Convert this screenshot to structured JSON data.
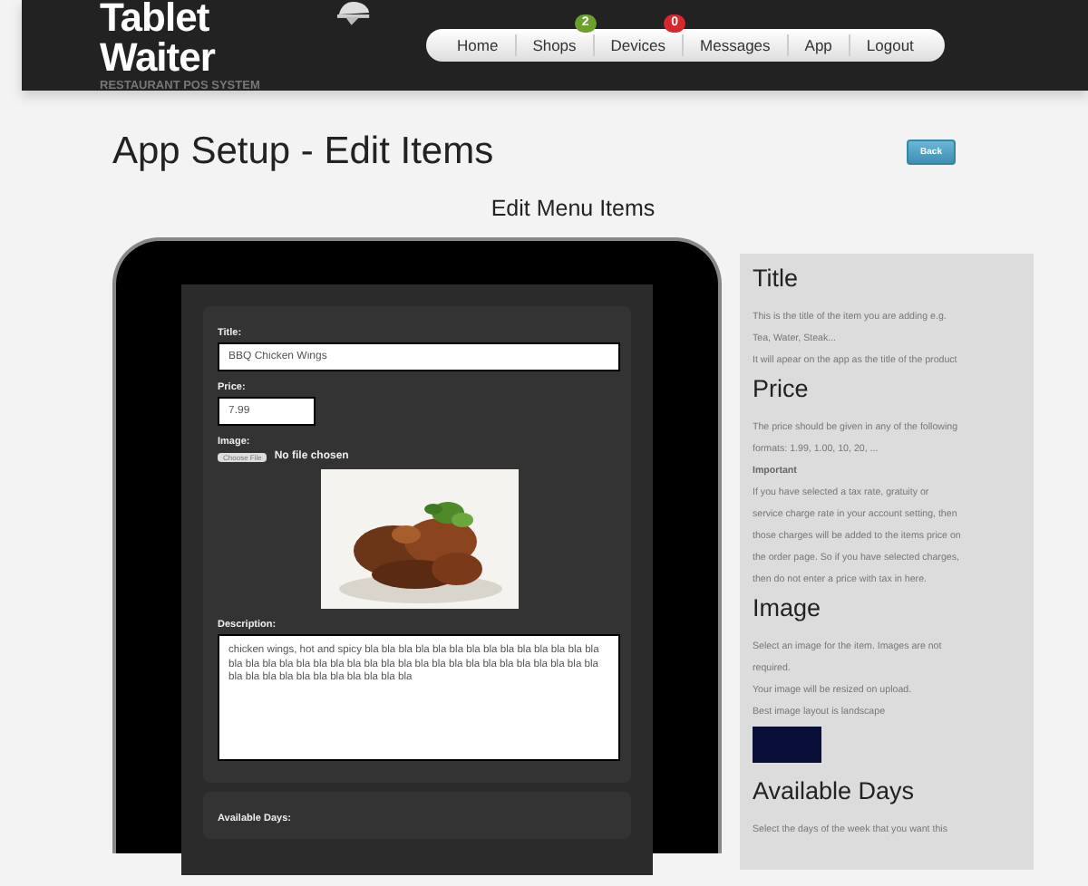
{
  "header": {
    "logo": "Tablet Waiter",
    "tagline": "RESTAURANT POS SYSTEM",
    "nav": [
      {
        "label": "Home"
      },
      {
        "label": "Shops",
        "badge": "2",
        "color": "#6aa12c"
      },
      {
        "label": "Devices",
        "badge": "0",
        "color": "#d8272d"
      },
      {
        "label": "Messages"
      },
      {
        "label": "App"
      },
      {
        "label": "Logout"
      }
    ]
  },
  "page": {
    "title": "App Setup - Edit Items",
    "back_button": "Back",
    "subtitle": "Edit Menu Items"
  },
  "form": {
    "title_label": "Title:",
    "title_value": "BBQ Chicken Wings",
    "price_label": "Price:",
    "price_value": "7.99",
    "image_label": "Image:",
    "file_button": "Choose File",
    "file_status": "No file chosen",
    "description_label": "Description:",
    "description_value": "chicken wings, hot and spicy bla bla bla bla bla bla bla bla bla bla bla bla bla bla bla bla bla bla bla bla bla bla bla bla bla bla bla bla bla bla bla bla bla bla bla bla bla bla bla bla bla bla bla bla bla bla bla",
    "days_label": "Available Days:"
  },
  "help": [
    {
      "heading": "Title",
      "lines": [
        {
          "kind": "text",
          "text": "This is the title of the item you are adding e.g."
        },
        {
          "kind": "text",
          "text": "Tea, Water, Steak..."
        },
        {
          "kind": "text",
          "text": "It will apear on the app as the title of the product"
        }
      ]
    },
    {
      "heading": "Price",
      "lines": [
        {
          "kind": "text",
          "text": "The price should be given in any of the following"
        },
        {
          "kind": "text",
          "text": "formats: 1.99, 1.00, 10, 20, ..."
        },
        {
          "kind": "label",
          "text": "Important"
        },
        {
          "kind": "text",
          "text": "If you have selected a tax rate, gratuity or"
        },
        {
          "kind": "text",
          "text": "service charge rate in your account setting, then"
        },
        {
          "kind": "text",
          "text": "those charges will be added to the items price on"
        },
        {
          "kind": "text",
          "text": "the order page. So if you have selected charges,"
        },
        {
          "kind": "text",
          "text": "then do not enter a price with tax in here."
        }
      ]
    },
    {
      "heading": "Image",
      "lines": [
        {
          "kind": "text",
          "text": "Select an image for the item. Images are not"
        },
        {
          "kind": "text",
          "text": "required."
        },
        {
          "kind": "text",
          "text": "Your image will be resized on upload."
        },
        {
          "kind": "text",
          "text": "Best image layout is landscape"
        },
        {
          "kind": "swatch",
          "color": "#0a0f3a"
        }
      ]
    },
    {
      "heading": "Available Days",
      "lines": [
        {
          "kind": "text",
          "text": "Select the days of the week that you want this"
        }
      ]
    }
  ]
}
